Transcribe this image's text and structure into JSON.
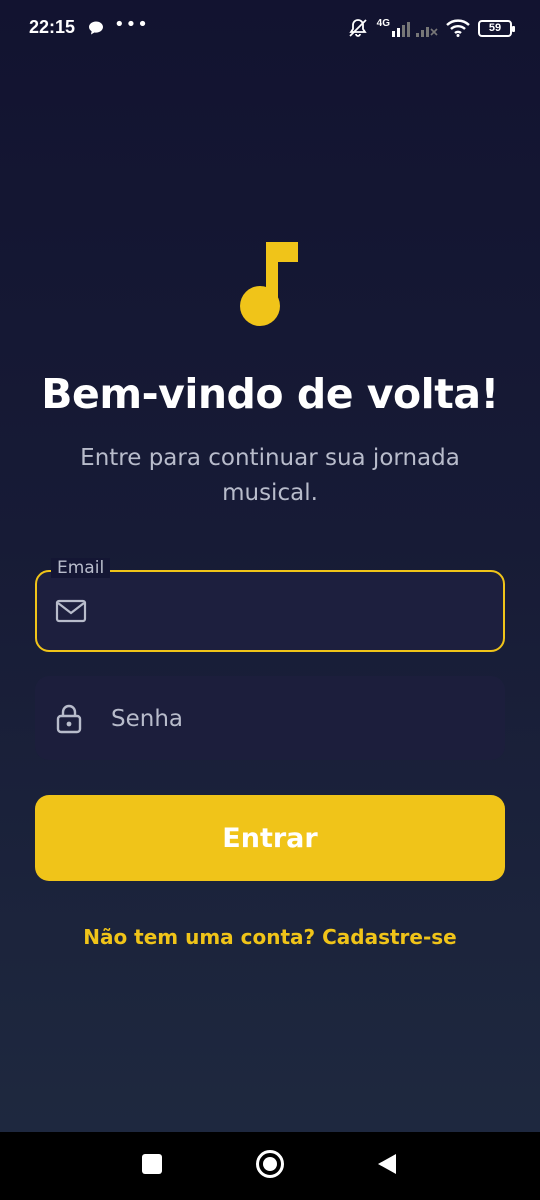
{
  "status_bar": {
    "time": "22:15",
    "more_indicator": "•••",
    "network_type": "4G",
    "battery_level": "59",
    "icons": [
      "chat-bubble-icon",
      "mute-icon",
      "signal-icon",
      "wifi-icon",
      "battery-icon"
    ]
  },
  "logo": {
    "icon": "music-note-icon",
    "color": "#f0c419"
  },
  "header": {
    "title": "Bem-vindo de volta!",
    "subtitle": "Entre para continuar sua jornada musical."
  },
  "form": {
    "email": {
      "label": "Email",
      "value": "",
      "icon": "mail-icon"
    },
    "password": {
      "placeholder": "Senha",
      "value": "",
      "icon": "lock-icon"
    },
    "submit_label": "Entrar"
  },
  "signup_link": "Não tem uma conta? Cadastre-se",
  "colors": {
    "accent": "#f0c419",
    "background_top": "#121330",
    "background_bottom": "#1f2a40",
    "field_background": "#1d1f3e",
    "muted_text": "#b8bccb"
  },
  "nav_bar": {
    "icons": [
      "recents-icon",
      "home-icon",
      "back-icon"
    ]
  }
}
